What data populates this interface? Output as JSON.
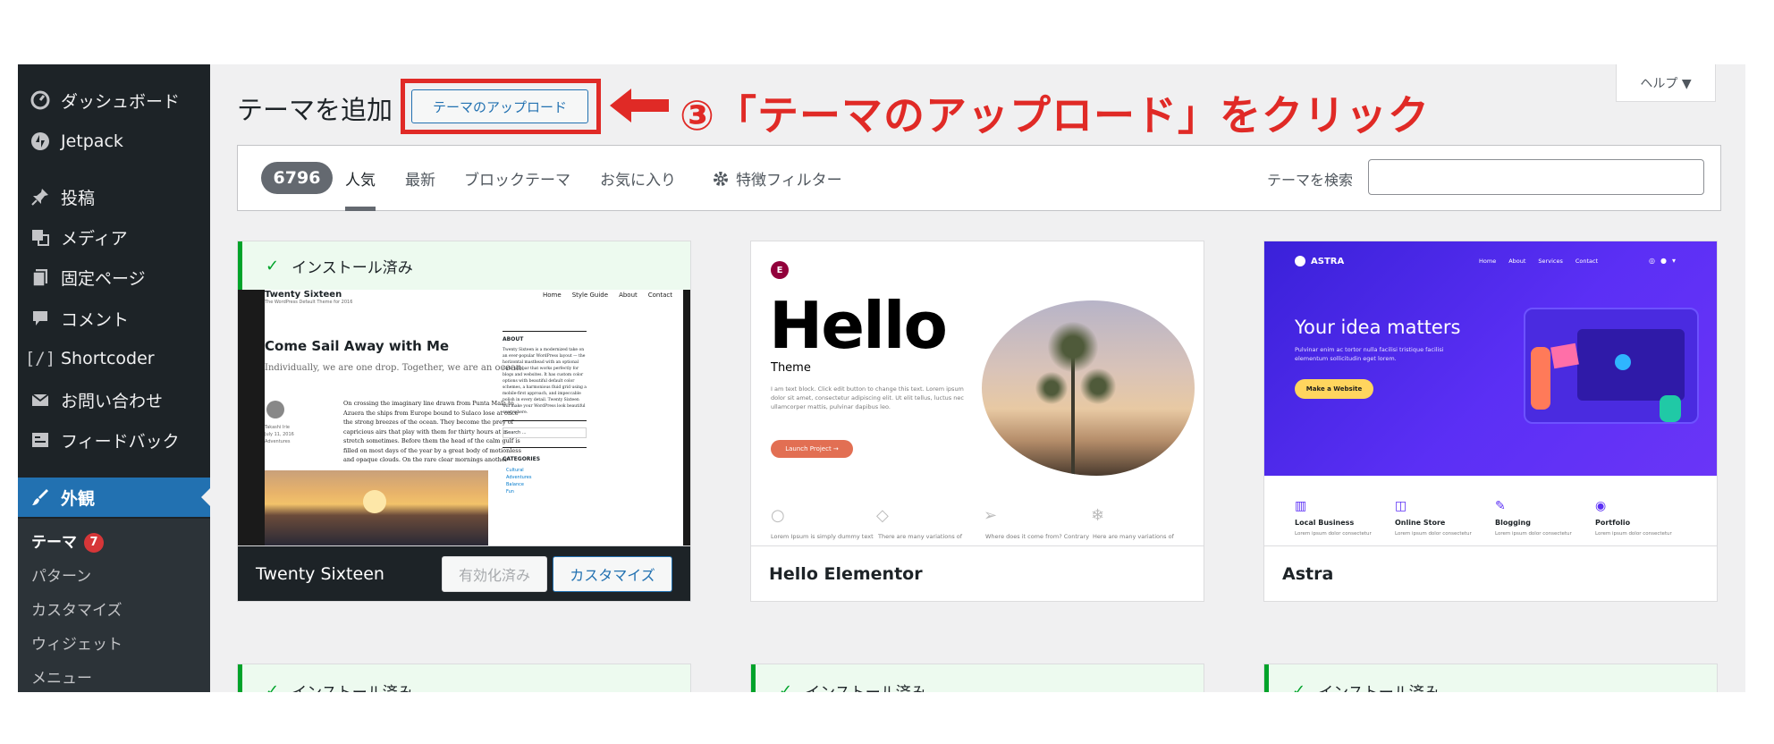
{
  "sidebar": {
    "items": [
      {
        "label": "ダッシュボード",
        "icon": "dashboard-icon"
      },
      {
        "label": "Jetpack",
        "icon": "jetpack-icon"
      },
      {
        "label": "投稿",
        "icon": "pin-icon"
      },
      {
        "label": "メディア",
        "icon": "media-icon"
      },
      {
        "label": "固定ページ",
        "icon": "page-icon"
      },
      {
        "label": "コメント",
        "icon": "comment-icon"
      },
      {
        "label": "Shortcoder",
        "icon": "shortcode-icon"
      },
      {
        "label": "お問い合わせ",
        "icon": "mail-icon"
      },
      {
        "label": "フィードバック",
        "icon": "feedback-icon"
      },
      {
        "label": "外観",
        "icon": "brush-icon"
      }
    ],
    "submenu": [
      {
        "label": "テーマ",
        "badge": "7"
      },
      {
        "label": "パターン"
      },
      {
        "label": "カスタマイズ"
      },
      {
        "label": "ウィジェット"
      },
      {
        "label": "メニュー"
      }
    ]
  },
  "header": {
    "title": "テーマを追加",
    "upload_label": "テーマのアップロード",
    "help_label": "ヘルプ ▼"
  },
  "filter": {
    "count": "6796",
    "tabs": [
      "人気",
      "最新",
      "ブロックテーマ",
      "お気に入り",
      "特徴フィルター"
    ],
    "search_label": "テーマを検索"
  },
  "annotation": {
    "text": "③「テーマのアップロード」をクリック"
  },
  "themes": [
    {
      "name": "Twenty Sixteen",
      "installed_label": "インストール済み",
      "activated_label": "有効化済み",
      "customize_label": "カスタマイズ",
      "preview": {
        "site_title": "Twenty Sixteen",
        "tagline": "The WordPress Default Theme for 2016",
        "nav": [
          "Home",
          "Style Guide",
          "About",
          "Contact"
        ],
        "post_title": "Come Sail Away with Me",
        "post_lead": "Individually, we are one drop. Together, we are an ocean.",
        "body": "On crossing the imaginary line drawn from Punta Mala to Azuera the ships from Europe bound to Sulaco lose at once the strong breezes of the ocean. They become the prey of capricious airs that play with them for thirty hours at a stretch sometimes. Before them the head of the calm gulf is filled on most days of the year by a great body of motionless and opaque clouds. On the rare clear mornings another shadow is cast upon the sweep of the gulf.",
        "author": "Takashi Irie",
        "date": "July 11, 2016",
        "category": "Adventures",
        "about_heading": "ABOUT",
        "about_text": "Twenty Sixteen is a modernized take on an ever-popular WordPress layout — the horizontal masthead with an optional right sidebar that works perfectly for blogs and websites. It has custom color options with beautiful default color schemes, a harmonious fluid grid using a mobile-first approach, and impeccable polish in every detail. Twenty Sixteen will make your WordPress look beautiful everywhere.",
        "search_placeholder": "Search ...",
        "categories_heading": "CATEGORIES",
        "categories": [
          "Cultural",
          "Adventures",
          "Balance",
          "Fun"
        ]
      }
    },
    {
      "name": "Hello Elementor",
      "preview": {
        "logo": "E",
        "headline": "Hello",
        "sub": "Theme",
        "body": "Lorem ipsum dolor sit amet, consectetur adipiscing elit. Ut elit tellus, luctus nec ullamcorper mattis, pulvinar dapibus leo.",
        "intro": "I am text block. Click edit button to change this text. Lorem ipsum dolor sit amet, consectetur adipiscing elit. Ut elit tellus, luctus nec ullamcorper mattis, pulvinar dapibus leo.",
        "button": "Launch Project →",
        "features": [
          "Lorem Ipsum is simply dummy text",
          "There are many variations of",
          "Where does it come from? Contrary",
          "Here are many variations of"
        ]
      }
    },
    {
      "name": "Astra",
      "preview": {
        "logo": "ASTRA",
        "nav": [
          "Home",
          "About",
          "Services",
          "Contact"
        ],
        "headline": "Your idea matters",
        "body": "Pulvinar enim ac tortor nulla facilisi tristique facilisi elementum sollicitudin eget lorem.",
        "button": "Make a Website",
        "features": [
          "Local Business",
          "Online Store",
          "Blogging",
          "Portfolio"
        ],
        "feature_text": "Lorem ipsum dolor consectetur"
      }
    }
  ],
  "second_row": [
    {
      "installed_label": "インストール済み"
    },
    {
      "installed_label": "インストール済み"
    },
    {
      "installed_label": "インストール済み"
    }
  ],
  "colors": {
    "sidebar_bg": "#1d2327",
    "active_blue": "#2271b1",
    "annotation_red": "#e02a26",
    "installed_green": "#00a32a",
    "astra_purple": "#5b2ff5",
    "hello_button": "#e26f53"
  }
}
